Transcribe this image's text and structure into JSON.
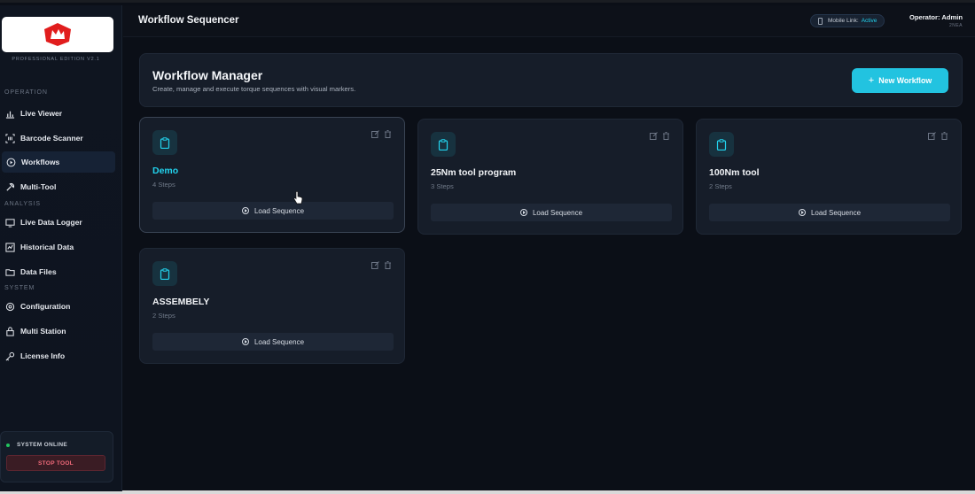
{
  "sidebar": {
    "edition": "PROFESSIONAL EDITION V2.1",
    "sections": {
      "operation": "OPERATION",
      "analysis": "ANALYSIS",
      "system": "SYSTEM"
    },
    "items": [
      {
        "label": "Live Viewer",
        "icon": "bar-chart-icon"
      },
      {
        "label": "Barcode Scanner",
        "icon": "barcode-icon"
      },
      {
        "label": "Workflows",
        "icon": "play-circle-icon",
        "active": true
      },
      {
        "label": "Multi-Tool",
        "icon": "wrench-icon"
      },
      {
        "label": "Live Data Logger",
        "icon": "monitor-icon"
      },
      {
        "label": "Historical Data",
        "icon": "chart-window-icon"
      },
      {
        "label": "Data Files",
        "icon": "folder-icon"
      },
      {
        "label": "Configuration",
        "icon": "gear-icon"
      },
      {
        "label": "Multi Station",
        "icon": "lock-icon"
      },
      {
        "label": "License Info",
        "icon": "key-icon"
      }
    ],
    "status_text": "SYSTEM ONLINE",
    "stop_label": "STOP TOOL"
  },
  "topbar": {
    "title": "Workflow Sequencer",
    "mobile_prefix": "Mobile Link:",
    "mobile_status": "Active",
    "operator": "Operator: Admin",
    "operator_sub": "2NEA"
  },
  "header": {
    "title": "Workflow Manager",
    "subtitle": "Create, manage and execute torque sequences with visual markers.",
    "new_button": "New Workflow"
  },
  "workflows": [
    {
      "name": "Demo",
      "steps": "4 Steps",
      "load_label": "Load Sequence"
    },
    {
      "name": "25Nm tool program",
      "steps": "3 Steps",
      "load_label": "Load Sequence"
    },
    {
      "name": "100Nm tool",
      "steps": "2 Steps",
      "load_label": "Load Sequence"
    },
    {
      "name": "ASSEMBELY",
      "steps": "2 Steps",
      "load_label": "Load Sequence"
    }
  ],
  "colors": {
    "accent": "#22c3e0",
    "active_text": "#22d3ee",
    "online": "#22c55e",
    "stop": "#f06a7a"
  }
}
